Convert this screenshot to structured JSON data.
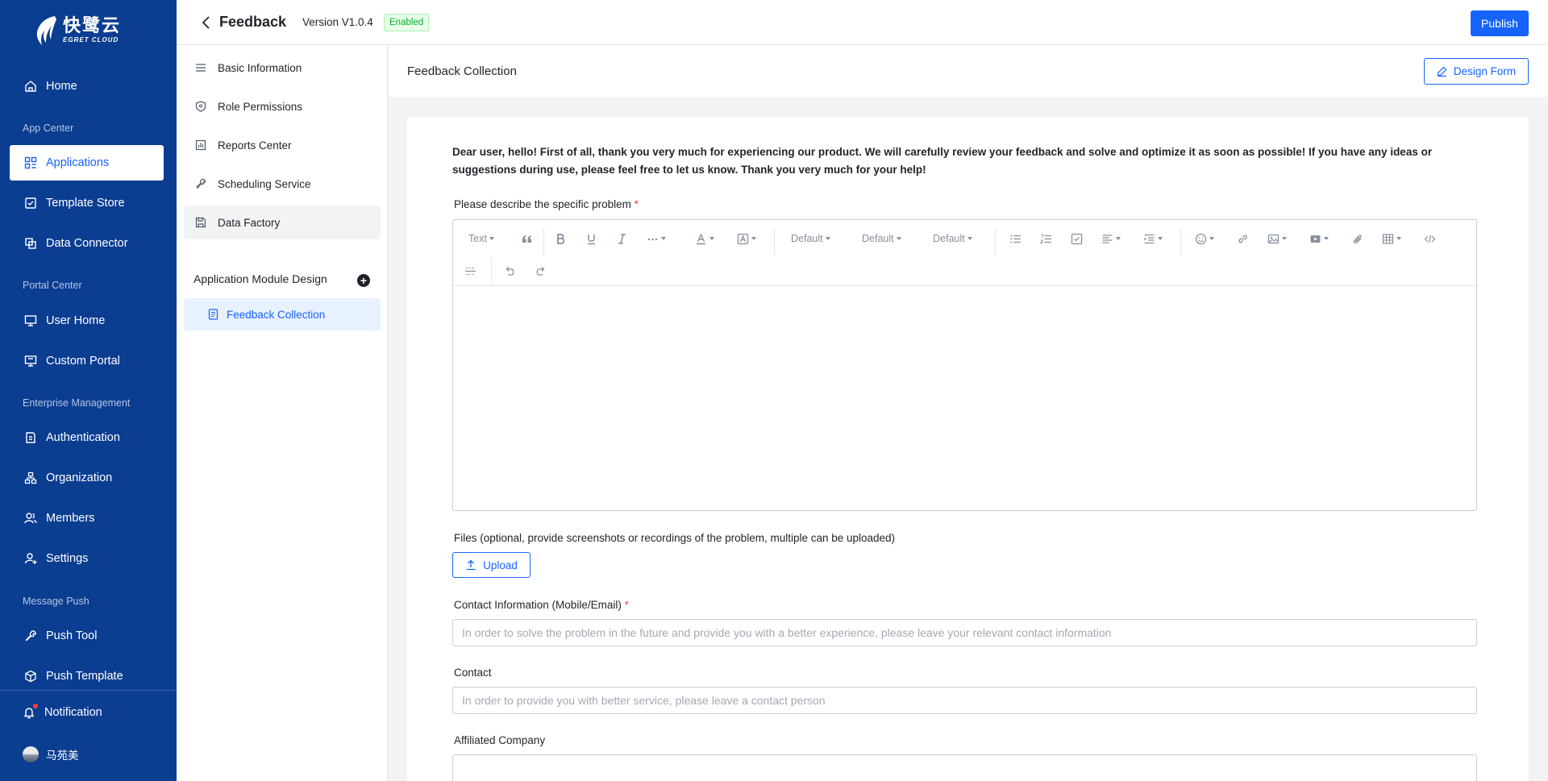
{
  "brand": {
    "name_cn": "快鹭云",
    "name_en": "EGRET CLOUD"
  },
  "nav": {
    "home": "Home",
    "sections": {
      "app_center": "App Center",
      "portal_center": "Portal Center",
      "enterprise": "Enterprise Management",
      "message_push": "Message Push"
    },
    "applications": "Applications",
    "template_store": "Template Store",
    "data_connector": "Data Connector",
    "user_home": "User Home",
    "custom_portal": "Custom Portal",
    "authentication": "Authentication",
    "organization": "Organization",
    "members": "Members",
    "settings": "Settings",
    "push_tool": "Push Tool",
    "push_template": "Push Template",
    "notification": "Notification",
    "user_name": "马苑美"
  },
  "header": {
    "title": "Feedback",
    "version": "Version V1.0.4",
    "status": "Enabled",
    "publish": "Publish"
  },
  "side": {
    "items": [
      "Basic Information",
      "Role Permissions",
      "Reports Center",
      "Scheduling Service",
      "Data Factory"
    ],
    "module_section": "Application Module Design",
    "add_symbol": "+",
    "module_item": "Feedback Collection"
  },
  "main": {
    "title": "Feedback Collection",
    "design_button": "Design Form",
    "intro": "Dear user, hello! First of all, thank you very much for experiencing our product. We will carefully review your feedback and solve and optimize it as soon as possible! If you have any ideas or suggestions during use, please feel free to let us know. Thank you very much for your help!",
    "problem_label": "Please describe the specific problem",
    "required_mark": "*",
    "toolbar": {
      "text": "Text",
      "default1": "Default",
      "default2": "Default",
      "default3": "Default"
    },
    "files_label": "Files (optional, provide screenshots or recordings of the problem, multiple can be uploaded)",
    "upload": "Upload",
    "contact_info_label": "Contact Information (Mobile/Email)",
    "contact_info_placeholder": "In order to solve the problem in the future and provide you with a better experience, please leave your relevant contact information",
    "contact_label": "Contact",
    "contact_placeholder": "In order to provide you with better service, please leave a contact person",
    "company_label": "Affiliated Company"
  },
  "colors": {
    "nav_bg": "#0b3d91",
    "primary": "#1664ff",
    "success": "#00b42a",
    "danger": "#f53f3f"
  }
}
